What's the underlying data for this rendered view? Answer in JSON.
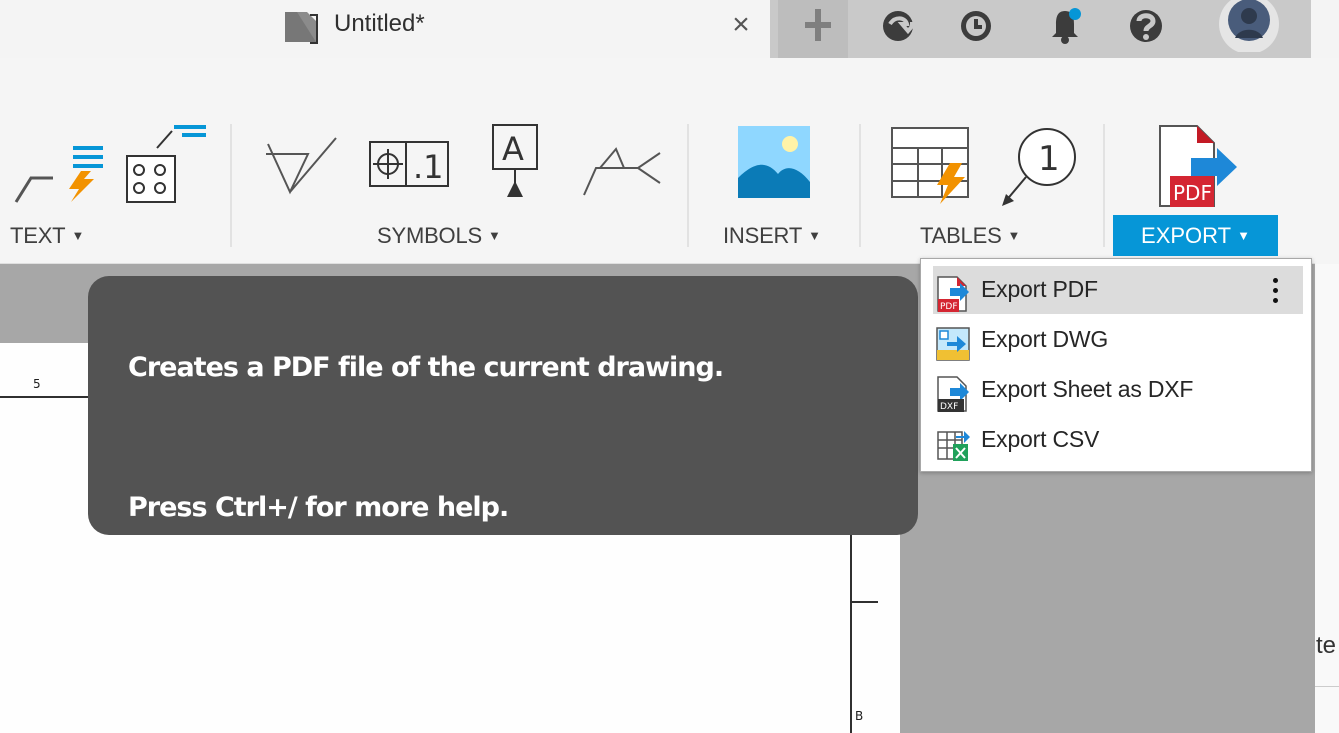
{
  "app": {
    "document_title": "Untitled*"
  },
  "tab": {
    "close_glyph": "×"
  },
  "ribbon": {
    "groups": [
      {
        "label": "TEXT",
        "caret": "▼"
      },
      {
        "label": "SYMBOLS",
        "caret": "▼"
      },
      {
        "label": "INSERT",
        "caret": "▼"
      },
      {
        "label": "TABLES",
        "caret": "▼"
      },
      {
        "label": "EXPORT",
        "caret": "▼"
      }
    ],
    "icons": {
      "balloon_number": "1",
      "datum_letter": "A",
      "feature_control_value": ".1",
      "pdf_badge": "PDF"
    },
    "accent_color": "#0696d7"
  },
  "tooltip": {
    "description": "Creates a PDF file of the current drawing.",
    "help": "Press Ctrl+/ for more help."
  },
  "dropdown": {
    "items": [
      {
        "label": "Export PDF",
        "icon": "pdf-export-icon",
        "active": true
      },
      {
        "label": "Export DWG",
        "icon": "dwg-export-icon",
        "active": false
      },
      {
        "label": "Export Sheet as DXF",
        "icon": "dxf-export-icon",
        "active": false
      },
      {
        "label": "Export CSV",
        "icon": "csv-export-icon",
        "active": false
      }
    ],
    "icon_text": {
      "pdf": "PDF",
      "dxf": "DXF"
    }
  },
  "sheet": {
    "zone_number": "5",
    "zone_letter": "B"
  },
  "right_strip": {
    "partial_text": "te"
  }
}
